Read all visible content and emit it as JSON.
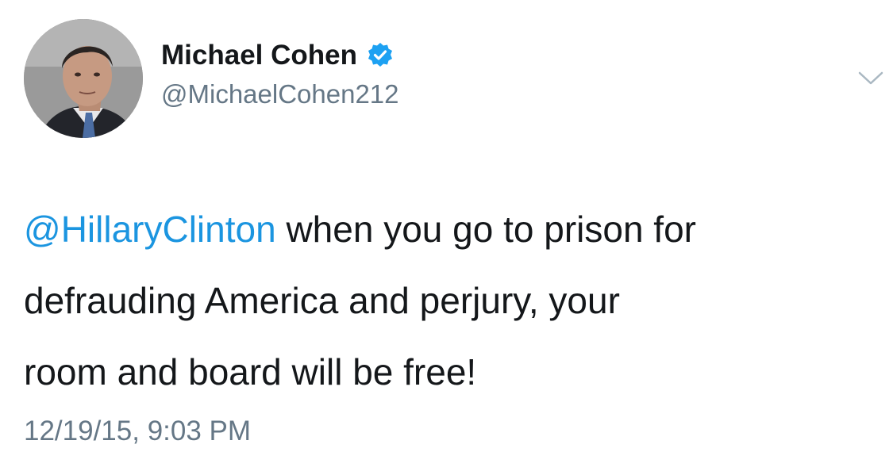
{
  "author": {
    "display_name": "Michael Cohen",
    "handle": "@MichaelCohen212",
    "verified": true
  },
  "avatar_icon": "profile-photo",
  "menu_icon": "chevron-down-icon",
  "tweet": {
    "mention": "@HillaryClinton",
    "text_line1": " when you go to prison for",
    "text_line2": "defrauding America and perjury, your",
    "text_line3": "room and board will be free!"
  },
  "timestamp": "12/19/15, 9:03 PM",
  "colors": {
    "link": "#1b95e0",
    "secondary_text": "#657786",
    "primary_text": "#14171a",
    "verified_badge": "#1da1f2"
  }
}
